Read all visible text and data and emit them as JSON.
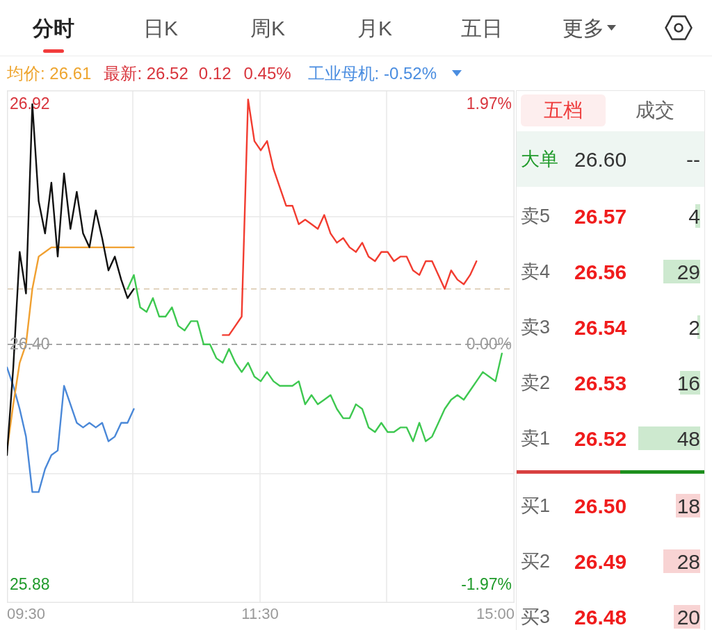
{
  "tabs": [
    {
      "label": "分时",
      "selected": true,
      "kind": "tab"
    },
    {
      "label": "日K",
      "selected": false,
      "kind": "tab"
    },
    {
      "label": "周K",
      "selected": false,
      "kind": "tab"
    },
    {
      "label": "月K",
      "selected": false,
      "kind": "tab"
    },
    {
      "label": "五日",
      "selected": false,
      "kind": "tab"
    },
    {
      "label": "更多",
      "selected": false,
      "kind": "menu"
    }
  ],
  "quote_bar": {
    "items": [
      {
        "text": "均价: 26.61",
        "color": "#eea52f"
      },
      {
        "text": "最新: 26.52",
        "color": "#d8343c"
      },
      {
        "text": "0.12",
        "color": "#d8343c"
      },
      {
        "text": "0.45%",
        "color": "#d8343c"
      },
      {
        "text": "工业母机: -0.52%",
        "color": "#4a8de0"
      }
    ]
  },
  "chart": {
    "right_axis": [
      "1.97%",
      "0.00%",
      "-1.97%"
    ],
    "time_axis": [
      "09:30",
      "11:30",
      "15:00"
    ],
    "chart_data": {
      "type": "line",
      "categories": [
        null,
        null,
        null,
        null,
        null,
        null,
        null,
        null,
        null,
        null,
        null,
        null,
        null,
        null,
        null,
        null,
        null,
        null,
        null,
        null,
        null,
        null,
        null,
        null,
        null,
        null,
        null,
        null,
        null,
        null,
        null,
        null,
        null,
        null,
        null,
        null,
        null,
        null,
        null,
        null,
        null,
        null,
        null,
        null,
        null,
        null,
        null,
        null,
        null,
        null,
        null,
        null,
        null,
        null,
        null,
        null,
        null,
        null,
        null,
        null,
        null,
        null,
        null,
        null,
        null,
        null,
        null,
        null,
        null,
        null,
        null,
        null,
        null,
        null,
        null,
        null,
        null,
        null,
        null,
        null,
        null
      ],
      "series": [
        {
          "color": "#3ec850",
          "values": [
            null,
            null,
            null,
            null,
            null,
            null,
            null,
            null,
            null,
            null,
            null,
            null,
            null,
            null,
            null,
            null,
            null,
            null,
            null,
            26.52,
            26.55,
            26.48,
            26.47,
            26.5,
            26.46,
            26.46,
            26.48,
            26.44,
            26.43,
            26.45,
            26.45,
            26.4,
            26.4,
            26.37,
            26.36,
            26.39,
            26.36,
            26.34,
            26.36,
            26.33,
            26.32,
            26.34,
            26.32,
            26.31,
            26.31,
            26.31,
            26.32,
            26.27,
            26.29,
            26.27,
            26.28,
            26.29,
            26.26,
            26.24,
            26.24,
            26.27,
            26.26,
            26.22,
            26.21,
            26.23,
            26.21,
            26.21,
            26.22,
            26.22,
            26.19,
            26.23,
            26.19,
            26.2,
            26.23,
            26.26,
            26.28,
            26.29,
            26.28,
            26.3,
            26.32,
            26.34,
            26.33,
            26.32,
            26.38,
            null,
            null
          ]
        },
        {
          "color": "#f23c30",
          "values": [
            null,
            null,
            null,
            null,
            null,
            null,
            null,
            null,
            null,
            null,
            null,
            null,
            null,
            null,
            null,
            null,
            null,
            null,
            null,
            null,
            null,
            null,
            null,
            null,
            null,
            null,
            null,
            null,
            null,
            null,
            null,
            null,
            null,
            null,
            26.42,
            26.42,
            26.44,
            26.46,
            26.93,
            26.84,
            26.82,
            26.84,
            26.78,
            26.74,
            26.7,
            26.7,
            26.66,
            26.67,
            26.66,
            26.65,
            26.68,
            26.64,
            26.62,
            26.63,
            26.61,
            26.6,
            26.62,
            26.59,
            26.58,
            26.6,
            26.6,
            26.58,
            26.59,
            26.59,
            26.56,
            26.55,
            26.58,
            26.58,
            26.55,
            26.52,
            26.56,
            26.54,
            26.53,
            26.55,
            26.58,
            null,
            null,
            null,
            null,
            null,
            null
          ]
        },
        {
          "color": "#4a88d8",
          "values": [
            26.35,
            26.31,
            26.26,
            26.2,
            26.08,
            26.08,
            26.13,
            26.16,
            26.17,
            26.31,
            26.27,
            26.23,
            26.22,
            26.23,
            26.22,
            26.23,
            26.19,
            26.2,
            26.23,
            26.23,
            26.26,
            null,
            null,
            null,
            null,
            null,
            null,
            null,
            null,
            null,
            null,
            null,
            null,
            null,
            null,
            null,
            null,
            null,
            null,
            null,
            null,
            null,
            null,
            null,
            null,
            null,
            null,
            null,
            null,
            null,
            null,
            null,
            null,
            null,
            null,
            null,
            null,
            null,
            null,
            null,
            null,
            null,
            null,
            null,
            null,
            null,
            null,
            null,
            null,
            null,
            null,
            null,
            null,
            null,
            null,
            null,
            null,
            null,
            null,
            null,
            null
          ]
        },
        {
          "color": "#f0a030",
          "values": [
            26.17,
            26.27,
            26.36,
            26.4,
            26.52,
            26.59,
            26.6,
            26.61,
            26.61,
            26.61,
            26.61,
            26.61,
            26.61,
            26.61,
            26.61,
            26.61,
            26.61,
            26.61,
            26.61,
            26.61,
            26.61,
            null,
            null,
            null,
            null,
            null,
            null,
            null,
            null,
            null,
            null,
            null,
            null,
            null,
            null,
            null,
            null,
            null,
            null,
            null,
            null,
            null,
            null,
            null,
            null,
            null,
            null,
            null,
            null,
            null,
            null,
            null,
            null,
            null,
            null,
            null,
            null,
            null,
            null,
            null,
            null,
            null,
            null,
            null,
            null,
            null,
            null,
            null,
            null,
            null,
            null,
            null,
            null,
            null,
            null,
            null,
            null,
            null,
            null,
            null,
            null
          ]
        },
        {
          "color": "#111111",
          "values": [
            26.16,
            26.35,
            26.6,
            26.51,
            26.92,
            26.71,
            26.64,
            26.75,
            26.59,
            26.77,
            26.65,
            26.73,
            26.64,
            26.61,
            26.69,
            26.63,
            26.56,
            26.59,
            26.54,
            26.5,
            26.52,
            null,
            null,
            null,
            null,
            null,
            null,
            null,
            null,
            null,
            null,
            null,
            null,
            null,
            null,
            null,
            null,
            null,
            null,
            null,
            null,
            null,
            null,
            null,
            null,
            null,
            null,
            null,
            null,
            null,
            null,
            null,
            null,
            null,
            null,
            null,
            null,
            null,
            null,
            null,
            null,
            null,
            null,
            null,
            null,
            null,
            null,
            null,
            null,
            null,
            null,
            null,
            null,
            null,
            null,
            null,
            null,
            null,
            null,
            null,
            null
          ]
        }
      ],
      "ylim": [
        25.84,
        26.95
      ],
      "yticks": [
        {
          "value": 26.92,
          "label": "26.92"
        },
        {
          "value": 26.4,
          "label": "26.40"
        },
        {
          "value": 25.88,
          "label": "25.88"
        }
      ],
      "grid": true,
      "ref_lines": [
        {
          "axis": "y",
          "value": 26.52,
          "color": "#d9c6aa"
        },
        {
          "axis": "y",
          "value": 26.4,
          "color": "#8a8a8a"
        }
      ]
    }
  },
  "order_book": {
    "tabs": [
      {
        "label": "五档",
        "selected": true
      },
      {
        "label": "成交",
        "selected": false
      }
    ],
    "big_order": {
      "label": "大单",
      "price": "26.60",
      "volume": "--"
    },
    "asks": [
      {
        "label": "卖5",
        "price": "26.57",
        "volume": "4",
        "level": 0.06
      },
      {
        "label": "卖4",
        "price": "26.56",
        "volume": "29",
        "level": 0.48
      },
      {
        "label": "卖3",
        "price": "26.54",
        "volume": "2",
        "level": 0.04
      },
      {
        "label": "卖2",
        "price": "26.53",
        "volume": "16",
        "level": 0.26
      },
      {
        "label": "卖1",
        "price": "26.52",
        "volume": "48",
        "level": 0.81
      }
    ],
    "ratio_bar": {
      "level": 0.55
    },
    "bids": [
      {
        "label": "买1",
        "price": "26.50",
        "volume": "18",
        "level": 0.32
      },
      {
        "label": "买2",
        "price": "26.49",
        "volume": "28",
        "level": 0.48
      },
      {
        "label": "买3",
        "price": "26.48",
        "volume": "20",
        "level": 0.35
      }
    ]
  }
}
